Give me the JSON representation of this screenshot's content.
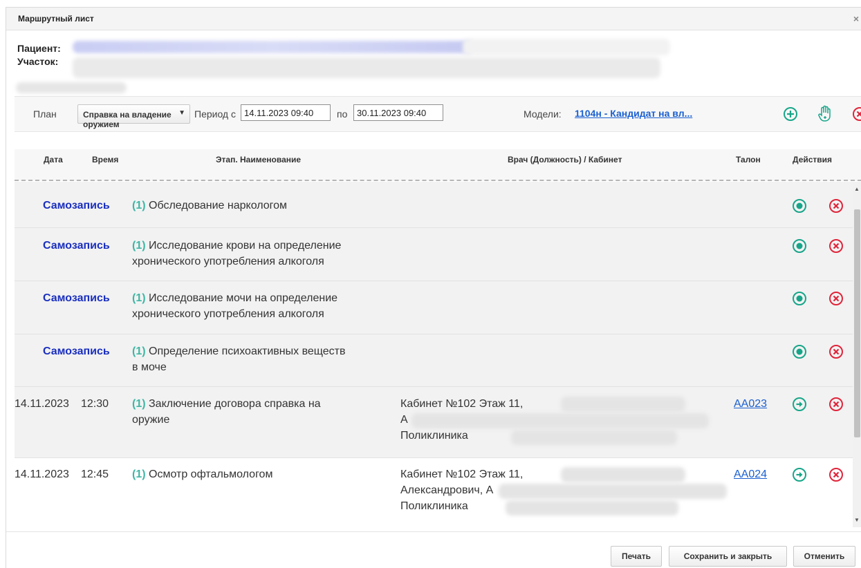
{
  "window": {
    "title": "Маршрутный лист",
    "close_label": "×"
  },
  "patient": {
    "label": "Пациент:",
    "value": ""
  },
  "district": {
    "label": "Участок:",
    "value": ""
  },
  "toolbar": {
    "plan_label": "План",
    "plan_value": "Справка на владение оружием",
    "period_from_label": "Период с",
    "period_from": "14.11.2023 09:40",
    "period_to_label": "по",
    "period_to": "30.11.2023 09:40",
    "models_label": "Модели:",
    "models_link": "1104н - Кандидат на вл..."
  },
  "columns": {
    "date": "Дата",
    "time": "Время",
    "stage": "Этап. Наименование",
    "doctor": "Врач (Должность) / Кабинет",
    "talon": "Талон",
    "actions": "Действия"
  },
  "rows": [
    {
      "date": "",
      "time": "",
      "self": "Самозапись",
      "num": "(1)",
      "line1": "Обследование наркологом",
      "line2": "",
      "doc1": "",
      "doc2": "",
      "doc3": "",
      "talon": ""
    },
    {
      "date": "",
      "time": "",
      "self": "Самозапись",
      "num": "(1)",
      "line1": "Исследование крови на определение",
      "line2": "хронического употребления алкоголя",
      "doc1": "",
      "doc2": "",
      "doc3": "",
      "talon": ""
    },
    {
      "date": "",
      "time": "",
      "self": "Самозапись",
      "num": "(1)",
      "line1": "Исследование мочи на определение",
      "line2": "хронического употребления алкоголя",
      "doc1": "",
      "doc2": "",
      "doc3": "",
      "talon": ""
    },
    {
      "date": "",
      "time": "",
      "self": "Самозапись",
      "num": "(1)",
      "line1": "Определение психоактивных веществ",
      "line2": "в моче",
      "doc1": "",
      "doc2": "",
      "doc3": "",
      "talon": ""
    },
    {
      "date": "14.11.2023",
      "time": "12:30",
      "self": "",
      "num": "(1)",
      "line1": "Заключение договора справка на",
      "line2": "оружие",
      "doc1": "Кабинет №102 Этаж 11,",
      "doc2": "А",
      "doc3": "Поликлиника",
      "talon": "АА023"
    },
    {
      "date": "14.11.2023",
      "time": "12:45",
      "self": "",
      "num": "(1)",
      "line1": "Осмотр офтальмологом",
      "line2": "",
      "doc1": "Кабинет №102 Этаж 11,",
      "doc2": "Александрович, А",
      "doc3": "Поликлиника",
      "talon": "АА024"
    }
  ],
  "footer": {
    "print": "Печать",
    "save_close": "Сохранить и закрыть",
    "cancel": "Отменить"
  },
  "colors": {
    "accent_green": "#17a589",
    "delete_red": "#e0243a",
    "link_blue": "#1a5fd1",
    "selfrecord_blue": "#1a2fbf"
  }
}
